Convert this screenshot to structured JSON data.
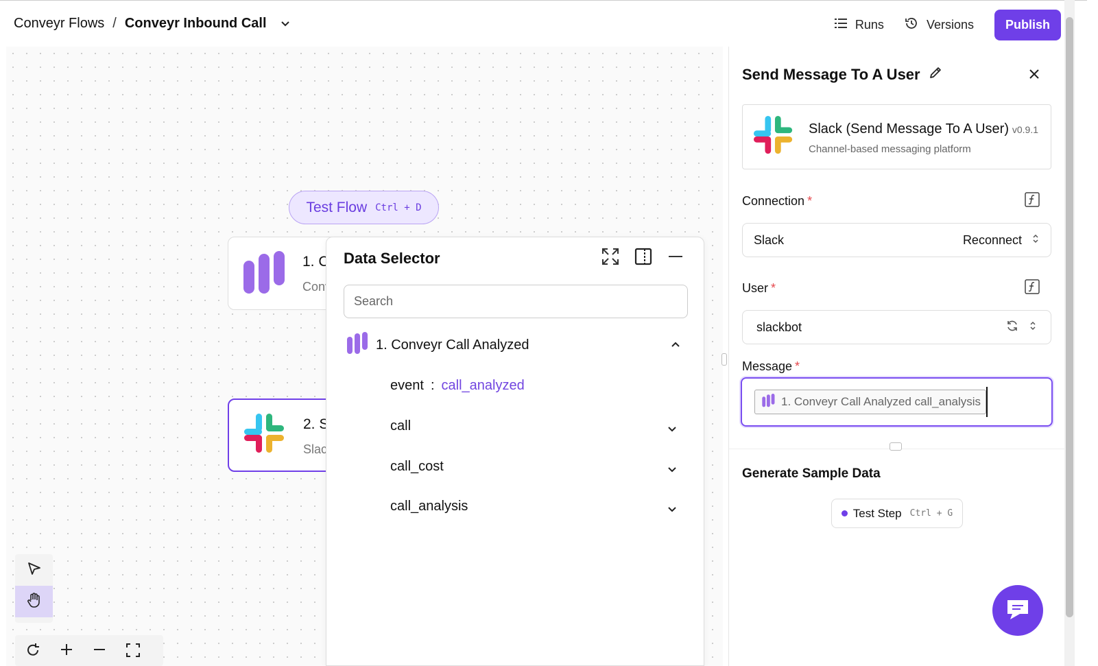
{
  "header": {
    "breadcrumb_root": "Conveyr Flows",
    "breadcrumb_sep": "/",
    "breadcrumb_current": "Conveyr Inbound Call",
    "runs_label": "Runs",
    "versions_label": "Versions",
    "publish_label": "Publish"
  },
  "canvas": {
    "test_flow_label": "Test Flow",
    "test_flow_shortcut": "Ctrl + D",
    "node1_title": "1. C",
    "node1_subtitle": "Conv",
    "node2_title": "2. S",
    "node2_subtitle": "Slac"
  },
  "data_selector": {
    "title": "Data Selector",
    "search_placeholder": "Search",
    "group_name": "1. Conveyr Call Analyzed",
    "event_key": "event",
    "event_colon": ":",
    "event_value": "call_analyzed",
    "items": [
      "call",
      "call_cost",
      "call_analysis"
    ]
  },
  "panel": {
    "title": "Send Message To A User",
    "piece_name": "Slack (Send Message To A User)",
    "piece_version": "v0.9.1",
    "piece_description": "Channel-based messaging platform",
    "connection_label": "Connection",
    "connection_value": "Slack",
    "connection_action": "Reconnect",
    "user_label": "User",
    "user_value": "slackbot",
    "message_label": "Message",
    "message_chip": "1. Conveyr Call Analyzed call_analysis",
    "required_mark": "*",
    "generate_title": "Generate Sample Data",
    "test_step_label": "Test Step",
    "test_step_shortcut": "Ctrl + G"
  },
  "colors": {
    "accent": "#6f3fe8",
    "required": "#e5484d"
  }
}
